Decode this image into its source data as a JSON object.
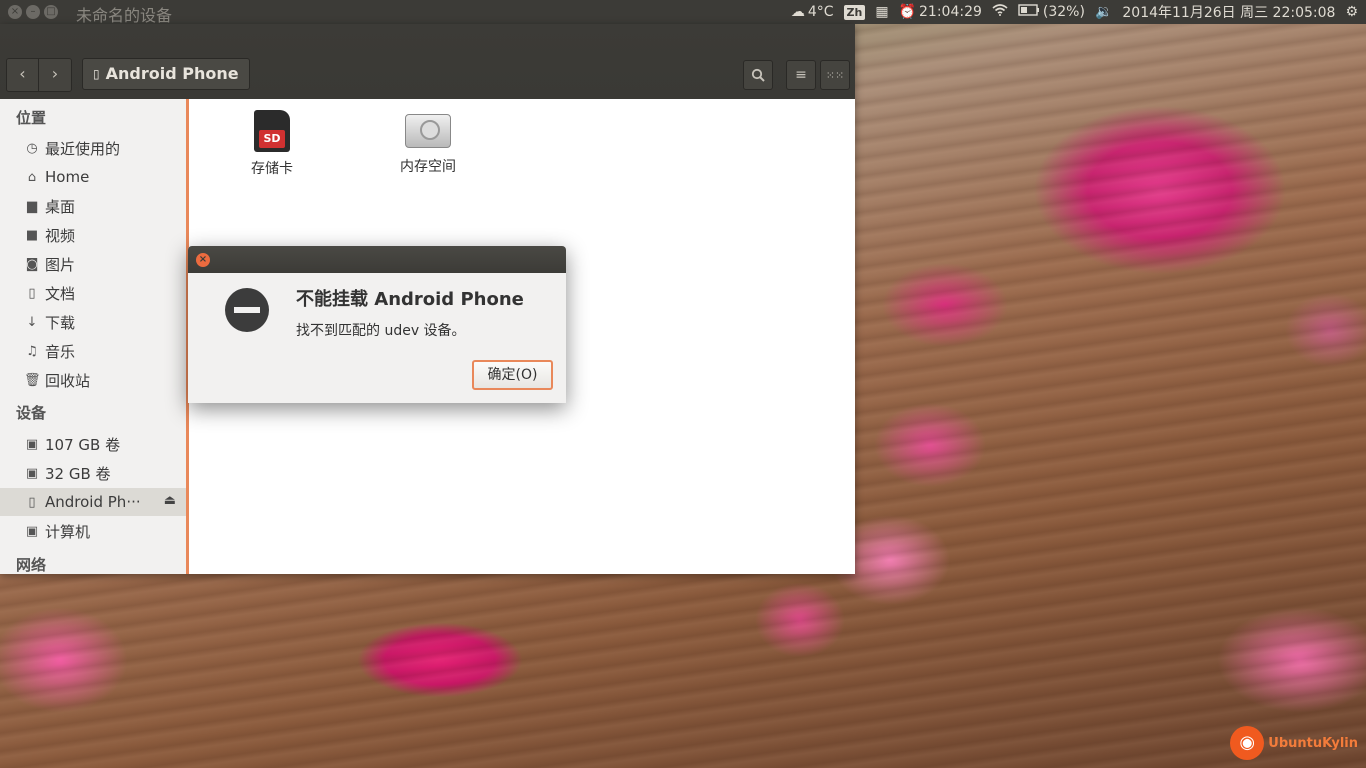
{
  "top_panel": {
    "window_title": "未命名的设备",
    "weather": "4°C",
    "input_method": "Zh",
    "alarm_time": "21:04:29",
    "battery": "(32%)",
    "datetime": "2014年11月26日 周三 22:05:08"
  },
  "toolbar": {
    "back": "‹",
    "forward": "›",
    "path_label": "Android Phone"
  },
  "sidebar": {
    "places_heading": "位置",
    "places": [
      {
        "label": "最近使用的",
        "icon": "clock-icon"
      },
      {
        "label": "Home",
        "icon": "home-icon"
      },
      {
        "label": "桌面",
        "icon": "folder-icon"
      },
      {
        "label": "视频",
        "icon": "video-icon"
      },
      {
        "label": "图片",
        "icon": "camera-icon"
      },
      {
        "label": "文档",
        "icon": "document-icon"
      },
      {
        "label": "下载",
        "icon": "download-icon"
      },
      {
        "label": "音乐",
        "icon": "music-icon"
      },
      {
        "label": "回收站",
        "icon": "trash-icon"
      }
    ],
    "devices_heading": "设备",
    "devices": [
      {
        "label": "107 GB 卷",
        "icon": "drive-icon"
      },
      {
        "label": "32 GB 卷",
        "icon": "drive-icon"
      },
      {
        "label": "Android Ph···",
        "icon": "phone-icon"
      },
      {
        "label": "计算机",
        "icon": "computer-icon"
      }
    ],
    "network_heading": "网络"
  },
  "content": {
    "files": [
      {
        "label": "存储卡",
        "icon": "sd-card-icon",
        "badge": "SD"
      },
      {
        "label": "内存空间",
        "icon": "hard-drive-icon"
      }
    ]
  },
  "dialog": {
    "title": "不能挂载 Android Phone",
    "message": "找不到匹配的 udev 设备。",
    "ok_label": "确定(O)"
  },
  "branding": {
    "logo_text": "UbuntuKylin"
  },
  "colors": {
    "accent": "#e9885a",
    "panel_bg": "#3c3b37",
    "sidebar_bg": "#f2f1f0",
    "close_button": "#ec6b3f"
  }
}
